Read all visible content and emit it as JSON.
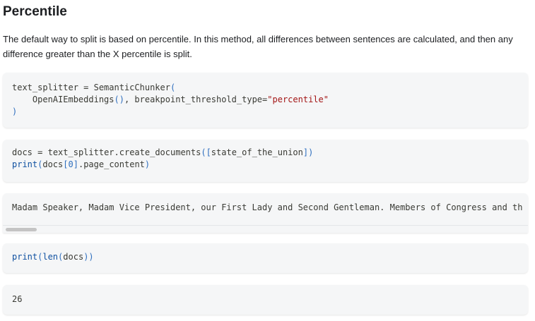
{
  "heading": "Percentile",
  "paragraph_line1": "The default way to split is based on percentile. In this method, all differences between sentences are calculated, and then any",
  "paragraph_line2": "difference greater than the X percentile is split.",
  "code_block_1": {
    "line1": {
      "var": "text_splitter",
      "eq": " = ",
      "cls": "SemanticChunker",
      "open": "("
    },
    "line2": {
      "indent": "    ",
      "fn": "OpenAIEmbeddings",
      "parens": "()",
      "comma": ", ",
      "kw": "breakpoint_threshold_type",
      "eq": "=",
      "str": "\"percentile\""
    },
    "line3": {
      "close": ")"
    }
  },
  "code_block_2": {
    "line1": {
      "var": "docs",
      "eq": " = ",
      "obj": "text_splitter",
      "dot": ".",
      "method": "create_documents",
      "open": "([",
      "arg": "state_of_the_union",
      "close": "])"
    },
    "line2": {
      "fn": "print",
      "open": "(",
      "obj": "docs",
      "lb": "[",
      "idx": "0",
      "rb": "]",
      "attr": ".page_content",
      "close": ")"
    }
  },
  "output_block_1": {
    "text": "Madam Speaker, Madam Vice President, our First Lady and Second Gentleman. Members of Congress and th"
  },
  "code_block_3": {
    "line1": {
      "fn": "print",
      "open": "(",
      "fn2": "len",
      "open2": "(",
      "arg": "docs",
      "close": "))"
    }
  },
  "output_block_2": {
    "text": "26"
  }
}
